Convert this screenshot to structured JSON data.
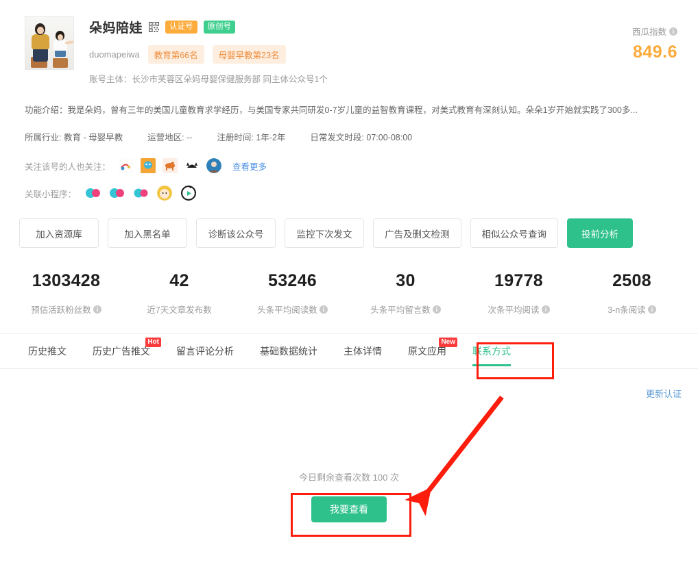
{
  "profile": {
    "account_name": "朵妈陪娃",
    "qr_icon": "qr-code-icon",
    "badges": [
      {
        "label": "认证号",
        "color": "#fdac3c"
      },
      {
        "label": "原创号",
        "color": "#3ecf8e"
      }
    ],
    "wechat_id": "duomapeiwa",
    "rank_tags": [
      "教育第66名",
      "母婴早教第23名"
    ],
    "subject_line": "账号主体：长沙市芙蓉区朵妈母婴保健服务部 同主体公众号1个",
    "description": "功能介绍：我是朵妈，曾有三年的美国儿童教育求学经历，与美国专家共同研发0-7岁儿童的益智教育课程，对美式教育有深刻认知。朵朵1岁开始就实践了300多...",
    "score": {
      "label": "西瓜指数",
      "value": "849.6",
      "color": "#fcab3b",
      "info_icon": "info-icon"
    },
    "meta": [
      {
        "label": "所属行业:",
        "value": "教育 - 母婴早教"
      },
      {
        "label": "运营地区:",
        "value": "--"
      },
      {
        "label": "注册时间:",
        "value": "1年-2年"
      },
      {
        "label": "日常发文时段:",
        "value": "07:00-08:00"
      }
    ],
    "related": {
      "label": "关注该号的人也关注：",
      "see_more": "查看更多",
      "avatar_count": 5
    },
    "miniprograms": {
      "label": "关联小程序：",
      "icon_count": 5
    }
  },
  "actions": {
    "buttons": [
      {
        "label": "加入资源库",
        "primary": false
      },
      {
        "label": "加入黑名单",
        "primary": false
      },
      {
        "label": "诊断该公众号",
        "primary": false
      },
      {
        "label": "监控下次发文",
        "primary": false
      },
      {
        "label": "广告及删文检测",
        "primary": false
      },
      {
        "label": "相似公众号查询",
        "primary": false
      },
      {
        "label": "投前分析",
        "primary": true
      }
    ],
    "primary_color": "#2fc18c"
  },
  "stats": [
    {
      "value": "1303428",
      "label": "预估活跃粉丝数",
      "info": true
    },
    {
      "value": "42",
      "label": "近7天文章发布数",
      "info": false
    },
    {
      "value": "53246",
      "label": "头条平均阅读数",
      "info": true
    },
    {
      "value": "30",
      "label": "头条平均留言数",
      "info": true
    },
    {
      "value": "19778",
      "label": "次条平均阅读",
      "info": true
    },
    {
      "value": "2508",
      "label": "3-n条阅读",
      "info": true
    }
  ],
  "tabs": [
    {
      "label": "历史推文",
      "badge": null,
      "active": false
    },
    {
      "label": "历史广告推文",
      "badge": "Hot",
      "active": false
    },
    {
      "label": "留言评论分析",
      "badge": null,
      "active": false
    },
    {
      "label": "基础数据统计",
      "badge": null,
      "active": false
    },
    {
      "label": "主体详情",
      "badge": null,
      "active": false
    },
    {
      "label": "原文应用",
      "badge": "New",
      "active": false
    },
    {
      "label": "联系方式",
      "badge": null,
      "active": true
    }
  ],
  "content": {
    "renew_link": "更新认证",
    "remaining_text": "今日剩余查看次数 100 次",
    "view_button": "我要查看"
  },
  "annotations": {
    "highlight_color": "#fc1d0d",
    "boxes": [
      "contact-tab",
      "view-button"
    ],
    "arrow": "points-from-contact-tab-to-view-button"
  }
}
